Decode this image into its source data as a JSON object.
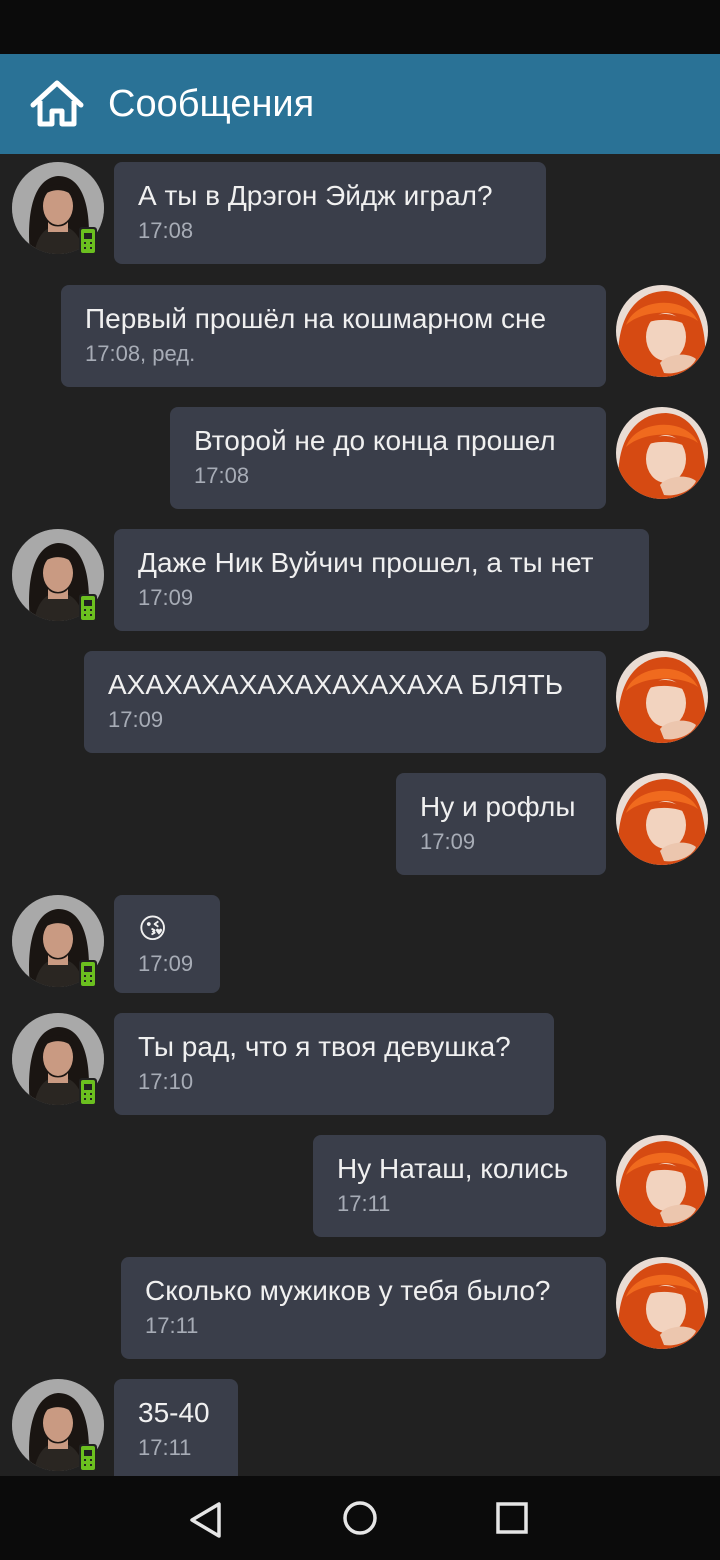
{
  "header": {
    "title": "Сообщения",
    "home_icon": "home-icon"
  },
  "colors": {
    "appbar": "#2a7296",
    "background": "#212121",
    "bubble": "#3a3e4a",
    "online_mobile": "#6bbf1f"
  },
  "messages": [
    {
      "side": "in",
      "text": "А ты в Дрэгон Эйдж играл?",
      "time": "17:08"
    },
    {
      "side": "out",
      "text": "Первый прошёл на кошмарном сне",
      "time": "17:08, ред."
    },
    {
      "side": "out",
      "text": "Второй не до конца прошел",
      "time": "17:08"
    },
    {
      "side": "in",
      "text": "Даже Ник Вуйчич прошел, а ты нет",
      "time": "17:09"
    },
    {
      "side": "out",
      "text": "АХАХАХАХАХАХАХАХАХА БЛЯТЬ",
      "time": "17:09"
    },
    {
      "side": "out",
      "text": "Ну и рофлы",
      "time": "17:09"
    },
    {
      "side": "in",
      "text": "😘",
      "time": "17:09"
    },
    {
      "side": "in",
      "text": "Ты рад, что я твоя девушка?",
      "time": "17:10"
    },
    {
      "side": "out",
      "text": "Ну Наташ, колись",
      "time": "17:11"
    },
    {
      "side": "out",
      "text": "Сколько мужиков у тебя было?",
      "time": "17:11"
    },
    {
      "side": "in",
      "text": "35-40",
      "time": "17:11"
    }
  ],
  "navbar": {
    "back_icon": "back-triangle-icon",
    "home_icon": "home-circle-icon",
    "recents_icon": "recents-square-icon"
  }
}
